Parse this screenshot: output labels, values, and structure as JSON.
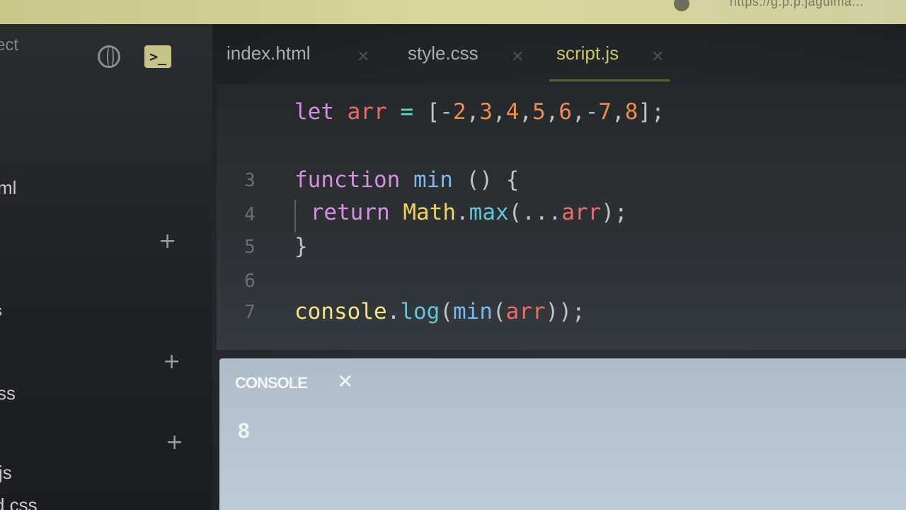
{
  "browser": {
    "url_fragment": "https://g.p.p.jaguima..."
  },
  "sidebar": {
    "project_label": "ect",
    "files": [
      "ml",
      "s",
      "ss",
      "js",
      "d css"
    ]
  },
  "tabs": [
    {
      "label": "index.html",
      "active": false
    },
    {
      "label": "style.css",
      "active": false
    },
    {
      "label": "script.js",
      "active": true
    }
  ],
  "editor": {
    "line_numbers": [
      "3",
      "4",
      "5",
      "6",
      "7"
    ],
    "lines": [
      "let arr = [-2,3,4,5,6,-7,8];",
      "",
      "function min () {",
      " return Math.max(...arr);",
      "}",
      "",
      "console.log(min(arr));"
    ]
  },
  "console": {
    "title": "CONSOLE",
    "output": "8"
  },
  "colors": {
    "keyword": "#d58fe0",
    "variable": "#ef6a6a",
    "number": "#ef8c4a",
    "function": "#7ab8f0",
    "class": "#f1d25a",
    "active_tab": "#c9c66a"
  }
}
